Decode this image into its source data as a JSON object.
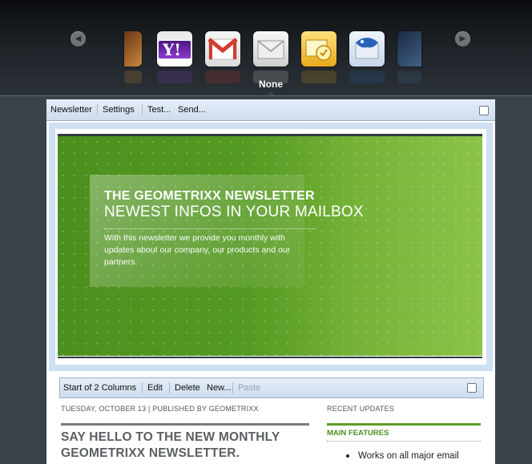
{
  "carousel": {
    "selected": "None",
    "tiles": [
      {
        "name": "partial-left-client-icon",
        "colors": [
          "#b1581d",
          "#e79a3f"
        ]
      },
      {
        "name": "yahoo-icon",
        "colors": [
          "#5b1c8e",
          "#9a4bd1"
        ]
      },
      {
        "name": "gmail-icon",
        "colors": [
          "#d8d8d8",
          "#ffffff"
        ]
      },
      {
        "name": "plain-envelope-icon",
        "colors": [
          "#bfbfbf",
          "#f1f1f1"
        ]
      },
      {
        "name": "outlook-icon",
        "colors": [
          "#e0a21b",
          "#ffd658"
        ]
      },
      {
        "name": "thunderbird-icon",
        "colors": [
          "#1d4f9b",
          "#6aa6e8"
        ]
      },
      {
        "name": "partial-right-client-icon",
        "colors": [
          "#1a2c4c",
          "#4a6f9c"
        ]
      }
    ],
    "yahoo_text": "Y!"
  },
  "toolbar": {
    "newsletter": "Newsletter",
    "settings": "Settings",
    "test": "Test...",
    "send": "Send..."
  },
  "banner": {
    "title": "THE GEOMETRIXX NEWSLETTER",
    "subtitle": "NEWEST INFOS IN YOUR MAILBOX",
    "text": "With this newsletter we provide you monthly with updates about our company, our products and our partners."
  },
  "columns_toolbar": {
    "start": "Start of 2 Columns",
    "edit": "Edit",
    "delete": "Delete",
    "new": "New...",
    "paste": "Paste"
  },
  "article": {
    "meta": "TUESDAY, OCTOBER 13 | PUBLISHED BY GEOMETRIXX",
    "headline": "SAY HELLO TO THE NEW MONTHLY GEOMETRIXX NEWSLETTER."
  },
  "sidebar": {
    "recent": "RECENT UPDATES",
    "features_title": "MAIN FEATURES",
    "features": [
      "Works on all major email"
    ]
  },
  "colors": {
    "accent_green": "#4e8f1f",
    "toolbar_blue": "#cddcee"
  }
}
